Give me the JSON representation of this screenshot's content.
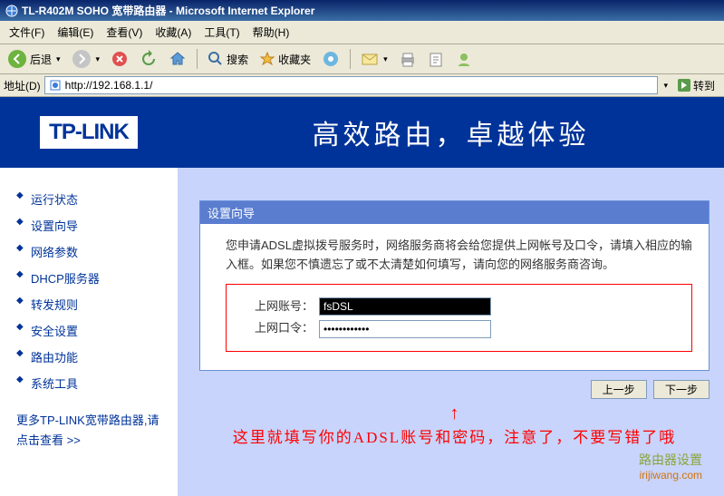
{
  "window": {
    "title": "TL-R402M SOHO 宽带路由器 - Microsoft Internet Explorer"
  },
  "menubar": {
    "file": "文件(F)",
    "edit": "编辑(E)",
    "view": "查看(V)",
    "favorites": "收藏(A)",
    "tools": "工具(T)",
    "help": "帮助(H)"
  },
  "toolbar": {
    "back": "后退",
    "search": "搜索",
    "favorites": "收藏夹"
  },
  "addressbar": {
    "label": "地址(D)",
    "url": "http://192.168.1.1/",
    "goto": "转到"
  },
  "header": {
    "logo": "TP-LINK",
    "slogan": "高效路由，卓越体验"
  },
  "sidebar": {
    "items": [
      "运行状态",
      "设置向导",
      "网络参数",
      "DHCP服务器",
      "转发规则",
      "安全设置",
      "路由功能",
      "系统工具"
    ],
    "more": "更多TP-LINK宽带路由器,请点击查看 >>"
  },
  "panel": {
    "title": "设置向导",
    "description": "您申请ADSL虚拟拨号服务时，网络服务商将会给您提供上网帐号及口令，请填入相应的输入框。如果您不慎遗忘了或不太清楚如何填写，请向您的网络服务商咨询。",
    "account_label": "上网账号：",
    "password_label": "上网口令：",
    "account_value": "fsDSL",
    "password_value": "••••••••••••",
    "prev_btn": "上一步",
    "next_btn": "下一步"
  },
  "annotation": {
    "arrow": "↑",
    "text": "这里就填写你的ADSL账号和密码，注意了，不要写错了哦"
  },
  "watermark": {
    "line1": "路由器设置",
    "line2": "irijiwang.com"
  }
}
